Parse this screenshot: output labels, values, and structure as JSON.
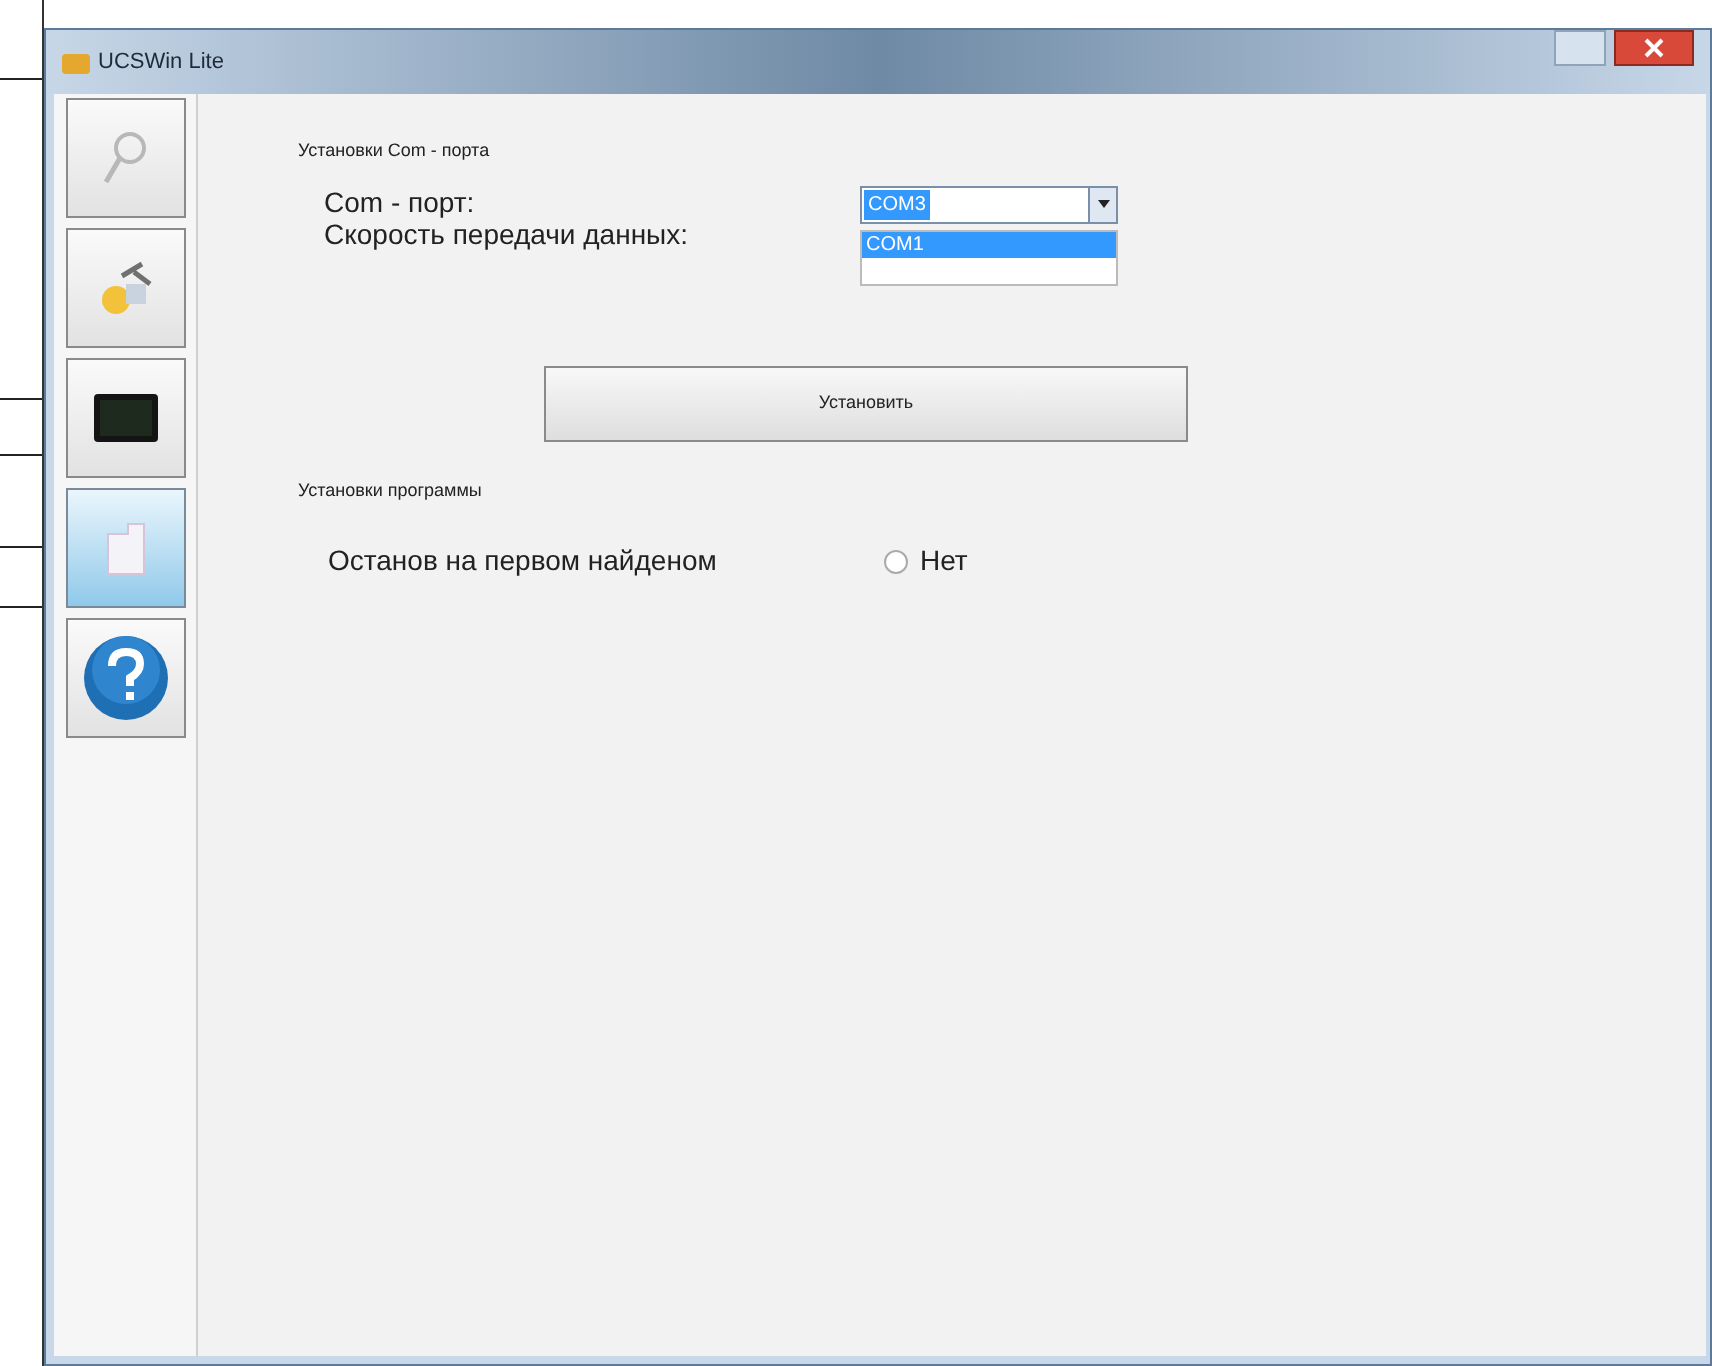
{
  "window": {
    "title": "UCSWin Lite"
  },
  "sidebar": {
    "items": [
      {
        "kind": "search",
        "selected": false
      },
      {
        "kind": "tools",
        "selected": false
      },
      {
        "kind": "terminal",
        "selected": false
      },
      {
        "kind": "folder",
        "selected": true
      },
      {
        "kind": "help",
        "selected": false
      }
    ]
  },
  "com_section": {
    "title": "Установки Com - порта",
    "labels": [
      "Com - порт:",
      "Скорость передачи данных:"
    ],
    "combo": {
      "value": "COM3"
    },
    "dropdown": {
      "items": [
        {
          "label": "COM1",
          "selected": true
        }
      ]
    }
  },
  "apply_button": "Установить",
  "program_section": {
    "title": "Установки программы",
    "option_label": "Останов на первом найденом",
    "radio": {
      "label": "Нет",
      "checked": false
    }
  }
}
